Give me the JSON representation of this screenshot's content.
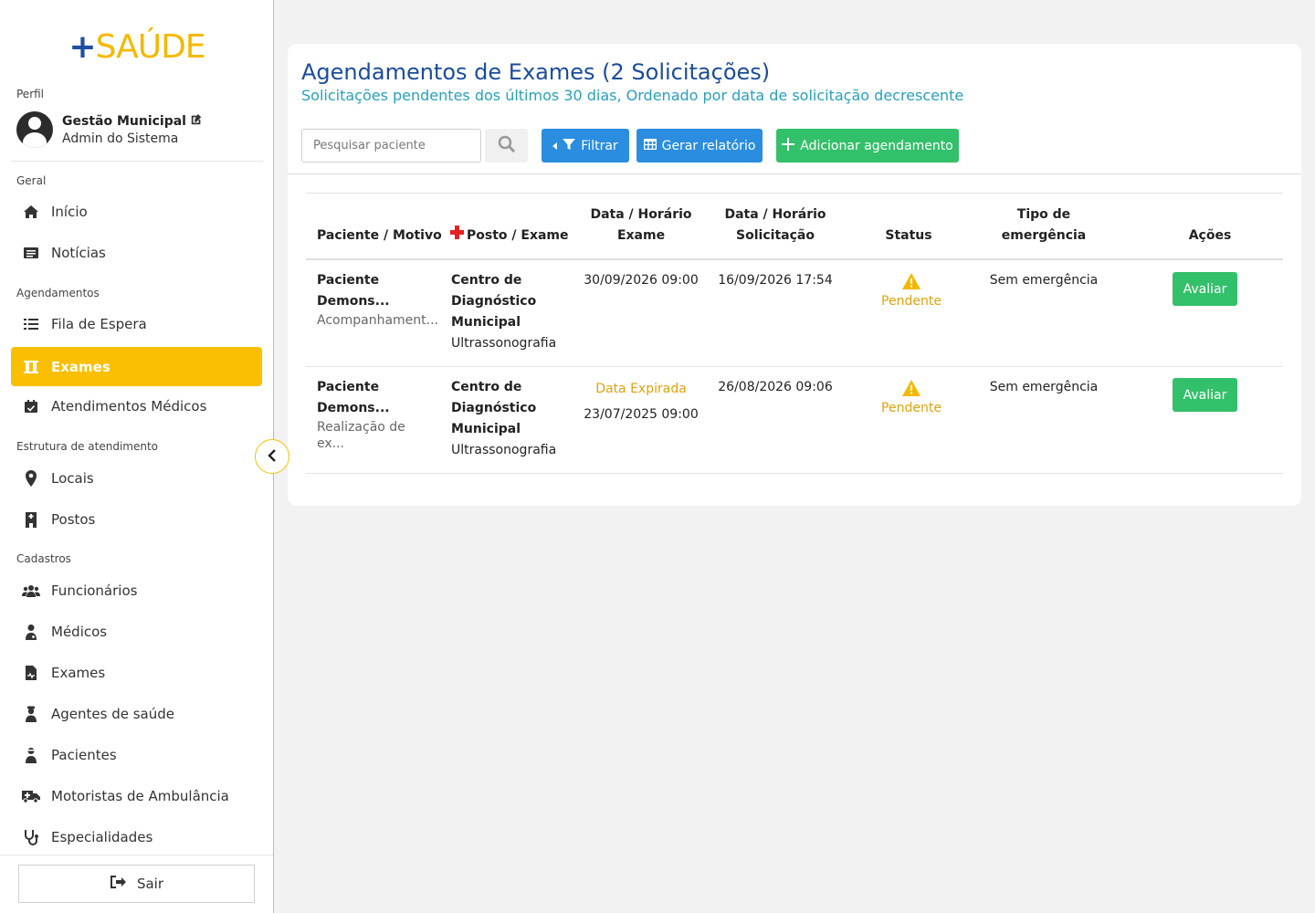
{
  "brand": {
    "plus": "+",
    "name": "SAÚDE",
    "blue": "#1f4fa3",
    "yellow": "#f5b800"
  },
  "profile": {
    "section_label": "Perfil",
    "name": "Gestão Municipal",
    "role": "Admin do Sistema"
  },
  "sections": {
    "geral": "Geral",
    "agendamentos": "Agendamentos",
    "estrutura": "Estrutura de atendimento",
    "cadastros": "Cadastros"
  },
  "nav": {
    "inicio": "Início",
    "noticias": "Notícias",
    "fila": "Fila de Espera",
    "exames": "Exames",
    "atendimentos": "Atendimentos Médicos",
    "locais": "Locais",
    "postos": "Postos",
    "funcionarios": "Funcionários",
    "medicos": "Médicos",
    "exames_cad": "Exames",
    "agentes": "Agentes de saúde",
    "pacientes": "Pacientes",
    "motoristas": "Motoristas de Ambulância",
    "especialidades": "Especialidades"
  },
  "logout_label": "Sair",
  "page": {
    "title": "Agendamentos de Exames (2 Solicitações)",
    "subtitle": "Solicitações pendentes dos últimos 30 dias, Ordenado por data de solicitação decrescente"
  },
  "toolbar": {
    "search_placeholder": "Pesquisar paciente",
    "filter_label": "Filtrar",
    "report_label": "Gerar relatório",
    "add_label": "Adicionar agendamento"
  },
  "table": {
    "headers": {
      "paciente": "Paciente / Motivo",
      "posto": "Posto / Exame",
      "data_exame_1": "Data / Horário",
      "data_exame_2": "Exame",
      "data_sol_1": "Data / Horário",
      "data_sol_2": "Solicitação",
      "status": "Status",
      "tipo_1": "Tipo de",
      "tipo_2": "emergência",
      "acoes": "Ações"
    },
    "rows": [
      {
        "patient": "Paciente Demons...",
        "motive": "Acompanhament...",
        "posto_1": "Centro de",
        "posto_2": "Diagnóstico",
        "posto_3": "Municipal",
        "exam": "Ultrassonografia",
        "exam_note": "",
        "exam_datetime": "30/09/2026 09:00",
        "request_datetime": "16/09/2026 17:54",
        "status": "Pendente",
        "emergency": "Sem emergência",
        "action": "Avaliar"
      },
      {
        "patient": "Paciente Demons...",
        "motive": "Realização de ex...",
        "posto_1": "Centro de",
        "posto_2": "Diagnóstico",
        "posto_3": "Municipal",
        "exam": "Ultrassonografia",
        "exam_note": "Data Expirada",
        "exam_datetime": "23/07/2025 09:00",
        "request_datetime": "26/08/2026 09:06",
        "status": "Pendente",
        "emergency": "Sem emergência",
        "action": "Avaliar"
      }
    ]
  },
  "colors": {
    "accent": "#f9bf00",
    "title": "#1b4c9a",
    "subtitle": "#27a0bd",
    "blue_btn": "#2a8de0",
    "green_btn": "#33c06a",
    "warning": "#e0a20b"
  },
  "icons": [
    "home-icon",
    "newspaper-icon",
    "list-icon",
    "flask-icon",
    "calendar-check-icon",
    "map-marker-icon",
    "building-icon",
    "users-icon",
    "user-doctor-icon",
    "file-medical-icon",
    "user-nurse-icon",
    "user-injured-icon",
    "ambulance-icon",
    "stethoscope-icon",
    "sign-out-icon",
    "chevron-left-icon",
    "search-icon",
    "filter-icon",
    "table-icon",
    "plus-icon",
    "warning-icon",
    "red-cross-icon",
    "edit-icon"
  ]
}
